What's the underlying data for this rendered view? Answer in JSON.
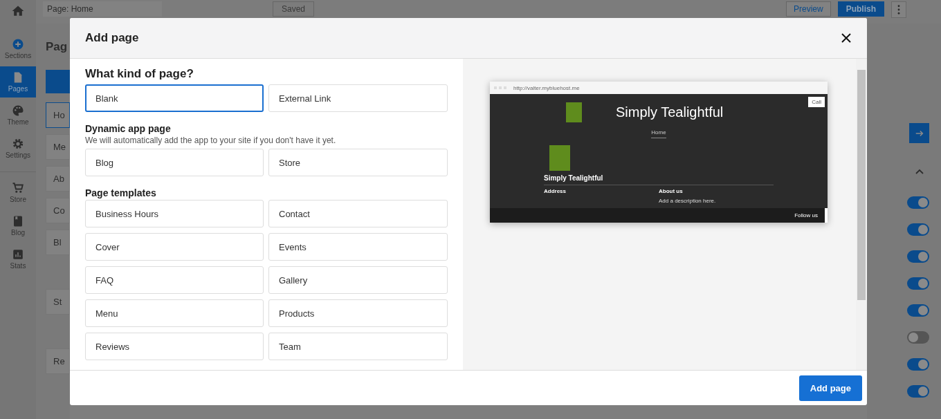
{
  "top_bar": {
    "page_select": {
      "label": "Page:",
      "value": "Home"
    },
    "saved_button": "Saved",
    "preview_button": "Preview",
    "publish_button": "Publish"
  },
  "rail": {
    "items": [
      {
        "label": "Sections",
        "selected": false
      },
      {
        "label": "Pages",
        "selected": true
      },
      {
        "label": "Theme",
        "selected": false
      },
      {
        "label": "Settings",
        "selected": false
      },
      {
        "label": "Store",
        "selected": false
      },
      {
        "label": "Blog",
        "selected": false
      },
      {
        "label": "Stats",
        "selected": false
      }
    ]
  },
  "pages_panel": {
    "title": "Pag",
    "items": [
      {
        "label": "Ho",
        "selected": true
      },
      {
        "label": "Me",
        "selected": false
      },
      {
        "label": "Ab",
        "selected": false
      },
      {
        "label": "Co",
        "selected": false
      },
      {
        "label": "Bl",
        "selected": false
      },
      {
        "label": "St",
        "selected": false
      },
      {
        "label": "Re",
        "selected": false
      }
    ]
  },
  "settings_panel": {
    "toggles": [
      {
        "on": true
      },
      {
        "on": true
      },
      {
        "on": true
      },
      {
        "on": true
      },
      {
        "on": true
      },
      {
        "on": false
      },
      {
        "on": true
      },
      {
        "on": true
      }
    ]
  },
  "dialog": {
    "title": "Add page",
    "sections": [
      {
        "heading": "What kind of page?",
        "options": [
          {
            "label": "Blank",
            "selected": true
          },
          {
            "label": "External Link",
            "selected": false
          }
        ]
      },
      {
        "heading": "Dynamic app page",
        "description": "We will automatically add the app to your site if you don't have it yet.",
        "options": [
          {
            "label": "Blog",
            "selected": false
          },
          {
            "label": "Store",
            "selected": false
          }
        ]
      },
      {
        "heading": "Page templates",
        "options": [
          {
            "label": "Business Hours",
            "selected": false
          },
          {
            "label": "Contact",
            "selected": false
          },
          {
            "label": "Cover",
            "selected": false
          },
          {
            "label": "Events",
            "selected": false
          },
          {
            "label": "FAQ",
            "selected": false
          },
          {
            "label": "Gallery",
            "selected": false
          },
          {
            "label": "Menu",
            "selected": false
          },
          {
            "label": "Products",
            "selected": false
          },
          {
            "label": "Reviews",
            "selected": false
          },
          {
            "label": "Team",
            "selected": false
          }
        ]
      }
    ],
    "preview": {
      "url": "http://valter.mybluehost.me",
      "site_title": "Simply Tealightful",
      "call_button": "Call",
      "nav_item": "Home",
      "heading": "Simply Tealightful",
      "columns": [
        {
          "heading": "Address"
        },
        {
          "heading": "About us",
          "text": "Add a description here."
        }
      ],
      "footer_text": "Follow us"
    },
    "primary_button": "Add page"
  }
}
